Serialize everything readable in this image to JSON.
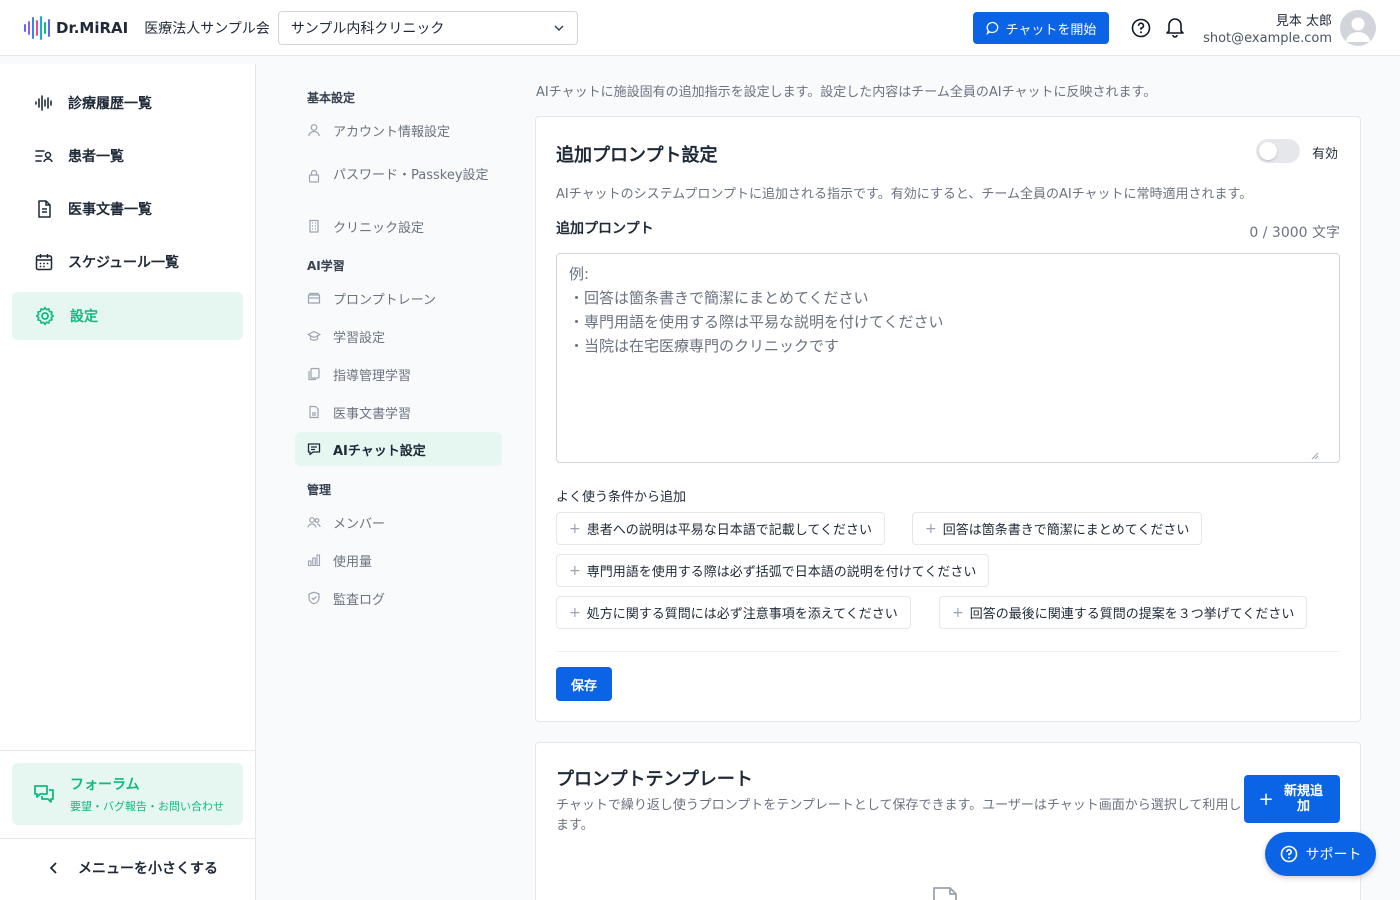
{
  "header": {
    "brand": "Dr.MiRAI",
    "org_name": "医療法人サンプル会",
    "clinic_select_value": "サンプル内科クリニック",
    "chat_button": "チャットを開始",
    "user_name": "見本 太郎",
    "user_email": "shot@example.com"
  },
  "sidebar": {
    "items": [
      {
        "label": "診療履歴一覧",
        "icon": "waveform-icon"
      },
      {
        "label": "患者一覧",
        "icon": "patient-list-icon"
      },
      {
        "label": "医事文書一覧",
        "icon": "document-icon"
      },
      {
        "label": "スケジュール一覧",
        "icon": "calendar-icon"
      },
      {
        "label": "設定",
        "icon": "gear-icon",
        "active": true
      }
    ],
    "forum_title": "フォーラム",
    "forum_subtitle": "要望・バグ報告・お問い合わせ",
    "collapse_label": "メニューを小さくする"
  },
  "subnav": {
    "sections": [
      "基本設定",
      "AI学習",
      "管理"
    ],
    "items": [
      {
        "label": "アカウント情報設定",
        "icon": "user-icon"
      },
      {
        "label": "パスワード・Passkey設定",
        "icon": "lock-icon"
      },
      {
        "label": "クリニック設定",
        "icon": "building-icon"
      },
      {
        "label": "プロンプトレーン",
        "icon": "folder-icon"
      },
      {
        "label": "学習設定",
        "icon": "graduation-cap-icon"
      },
      {
        "label": "指導管理学習",
        "icon": "copy-icon"
      },
      {
        "label": "医事文書学習",
        "icon": "file-icon"
      },
      {
        "label": "AIチャット設定",
        "icon": "chat-icon",
        "active": true
      },
      {
        "label": "メンバー",
        "icon": "users-icon"
      },
      {
        "label": "使用量",
        "icon": "bar-chart-icon"
      },
      {
        "label": "監査ログ",
        "icon": "shield-icon"
      }
    ]
  },
  "main": {
    "intro": "AIチャットに施設固有の追加指示を設定します。設定した内容はチーム全員のAIチャットに反映されます。",
    "prompt_card": {
      "title": "追加プロンプト設定",
      "toggle_label": "有効",
      "toggle_on": false,
      "description": "AIチャットのシステムプロンプトに追加される指示です。有効にすると、チーム全員のAIチャットに常時適用されます。",
      "field_label": "追加プロンプト",
      "counter": "0 / 3000 文字",
      "placeholder": "例:\n・回答は箇条書きで簡潔にまとめてください\n・専門用語を使用する際は平易な説明を付けてください\n・当院は在宅医療専門のクリニックです",
      "chips_label": "よく使う条件から追加",
      "chips": [
        "患者への説明は平易な日本語で記載してください",
        "回答は箇条書きで簡潔にまとめてください",
        "専門用語を使用する際は必ず括弧で日本語の説明を付けてください",
        "処方に関する質問には必ず注意事項を添えてください",
        "回答の最後に関連する質問の提案を３つ挙げてください"
      ],
      "save_button": "保存"
    },
    "template_card": {
      "title": "プロンプトテンプレート",
      "description": "チャットで繰り返し使うプロンプトをテンプレートとして保存できます。ユーザーはチャット画面から選択して利用します。",
      "new_button": "新規追加"
    }
  },
  "support_button": "サポート",
  "colors": {
    "primary": "#0b63e5",
    "accent": "#10b981",
    "accent_bg": "#e6f7f2"
  }
}
